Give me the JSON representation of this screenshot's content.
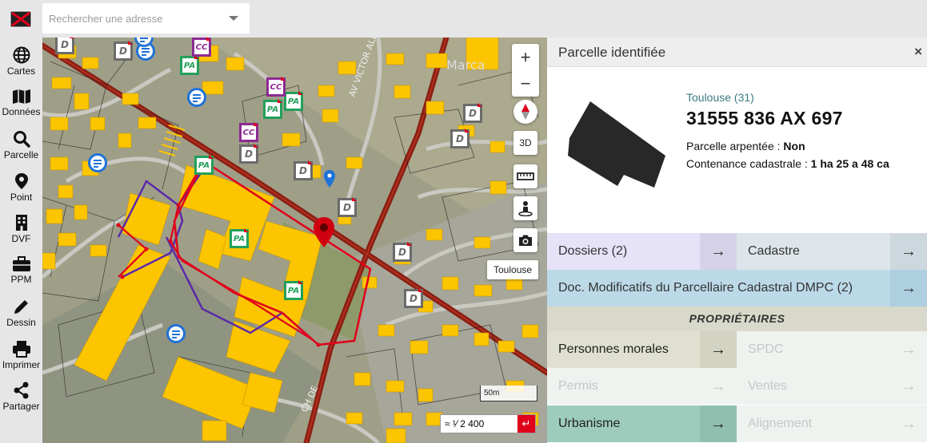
{
  "colors": {
    "accent_red": "#e0001a",
    "dossiers_bg": "#e6e2f7",
    "cadastre_bg": "#dde5ea",
    "dmpc_bg": "#bcd9e8",
    "section_bg": "#d8d9ca",
    "personnes_bg": "#dfe0cf",
    "urbanisme_bg": "#9dccbc",
    "disabled_bg": "#eef3f0"
  },
  "sidebar": {
    "items": [
      {
        "label": "Cartes",
        "icon": "globe-icon"
      },
      {
        "label": "Données",
        "icon": "map-icon"
      },
      {
        "label": "Parcelle",
        "icon": "search-icon"
      },
      {
        "label": "Point",
        "icon": "pin-icon"
      },
      {
        "label": "DVF",
        "icon": "building-icon"
      },
      {
        "label": "PPM",
        "icon": "briefcase-icon"
      },
      {
        "label": "Dessin",
        "icon": "pencil-icon"
      },
      {
        "label": "Imprimer",
        "icon": "printer-icon"
      },
      {
        "label": "Partager",
        "icon": "share-icon"
      }
    ]
  },
  "search": {
    "placeholder": "Rechercher une adresse"
  },
  "map": {
    "zoom_in": "+",
    "zoom_out": "−",
    "btn_3d": "3D",
    "city_tag": "Toulouse",
    "scale_label": "50m",
    "scale_value": "≈ ¹⁄ 2 400",
    "scale_go": "↵",
    "markers": [
      "D",
      "D",
      "D",
      "D",
      "D",
      "D",
      "D",
      "D",
      "D",
      "PA",
      "PA",
      "PA",
      "PA",
      "PA",
      "CC",
      "CC",
      "CC"
    ]
  },
  "panel": {
    "title": "Parcelle identifiée",
    "close": "×",
    "commune": "Toulouse (31)",
    "parcel_id": "31555 836 AX 697",
    "arpentee_label": "Parcelle arpentée : ",
    "arpentee_value": "Non",
    "contenance_label": "Contenance cadastrale : ",
    "contenance_value": "1 ha 25 a 48 ca",
    "dossiers": "Dossiers (2)",
    "cadastre": "Cadastre",
    "dmpc": "Doc. Modificatifs du Parcellaire Cadastral DMPC (2)",
    "section": "PROPRIÉTAIRES",
    "personnes_morales": "Personnes morales",
    "spdc": "SPDC",
    "permis": "Permis",
    "ventes": "Ventes",
    "urbanisme": "Urbanisme",
    "alignement": "Alignement",
    "arrow": "→"
  }
}
